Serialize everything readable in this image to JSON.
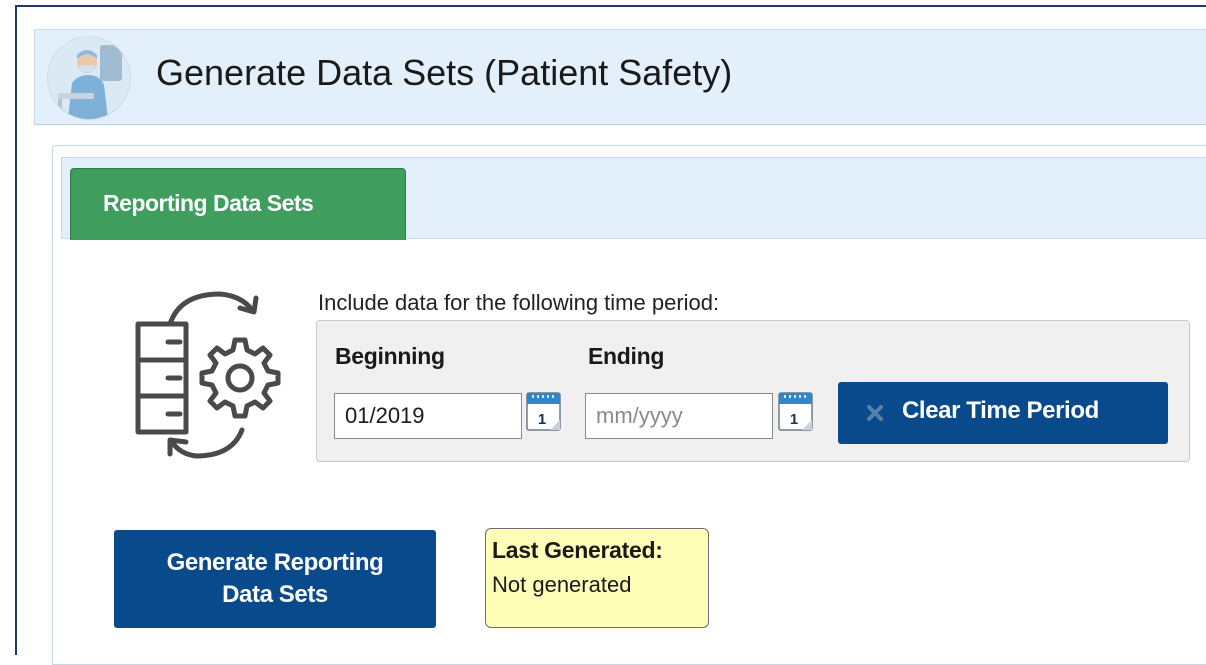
{
  "header": {
    "title": "Generate Data Sets (Patient Safety)",
    "avatar_icon": "healthcare-worker-avatar"
  },
  "tabs": [
    {
      "label": "Reporting Data Sets",
      "active": true
    }
  ],
  "time_period": {
    "instruction": "Include data for the following time period:",
    "beginning_label": "Beginning",
    "beginning_value": "01/2019",
    "ending_label": "Ending",
    "ending_value": "",
    "ending_placeholder": "mm/yyyy",
    "calendar_day": "1",
    "clear_button_label": "Clear Time Period"
  },
  "actions": {
    "generate_line1": "Generate Reporting",
    "generate_line2": "Data Sets"
  },
  "status": {
    "last_generated_label": "Last Generated:",
    "last_generated_value": "Not generated"
  },
  "colors": {
    "header_bg": "#e3f0fb",
    "tab_green": "#3f9e5e",
    "button_blue": "#094a8c",
    "status_yellow": "#ffffb8"
  }
}
